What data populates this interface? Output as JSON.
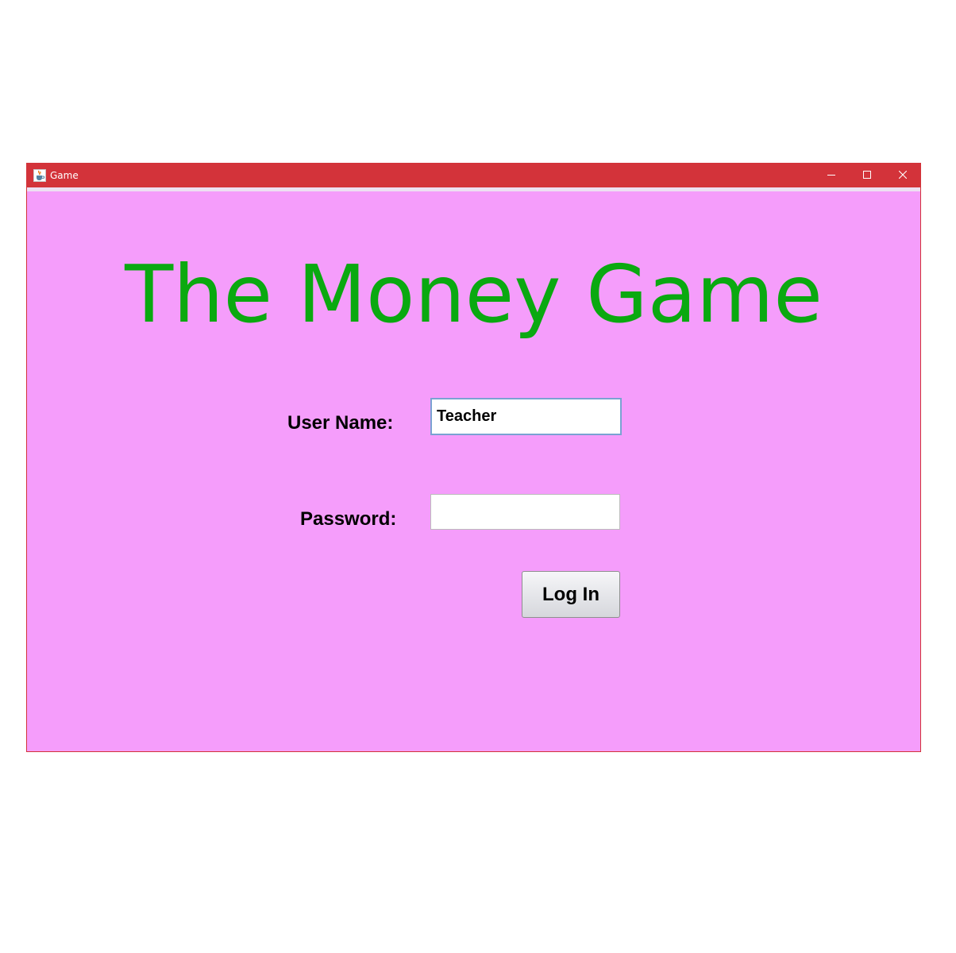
{
  "window": {
    "title": "Game",
    "icon": "java-cup-icon",
    "controls": [
      "minimize-icon",
      "maximize-icon",
      "close-icon"
    ]
  },
  "main": {
    "heading": "The Money Game",
    "username_label": "User Name:",
    "username_value": "Teacher",
    "password_label": "Password:",
    "password_value": "",
    "login_label": "Log In"
  },
  "colors": {
    "titlebar": "#d3333a",
    "background": "#f59dfb",
    "heading": "#0aa910"
  }
}
